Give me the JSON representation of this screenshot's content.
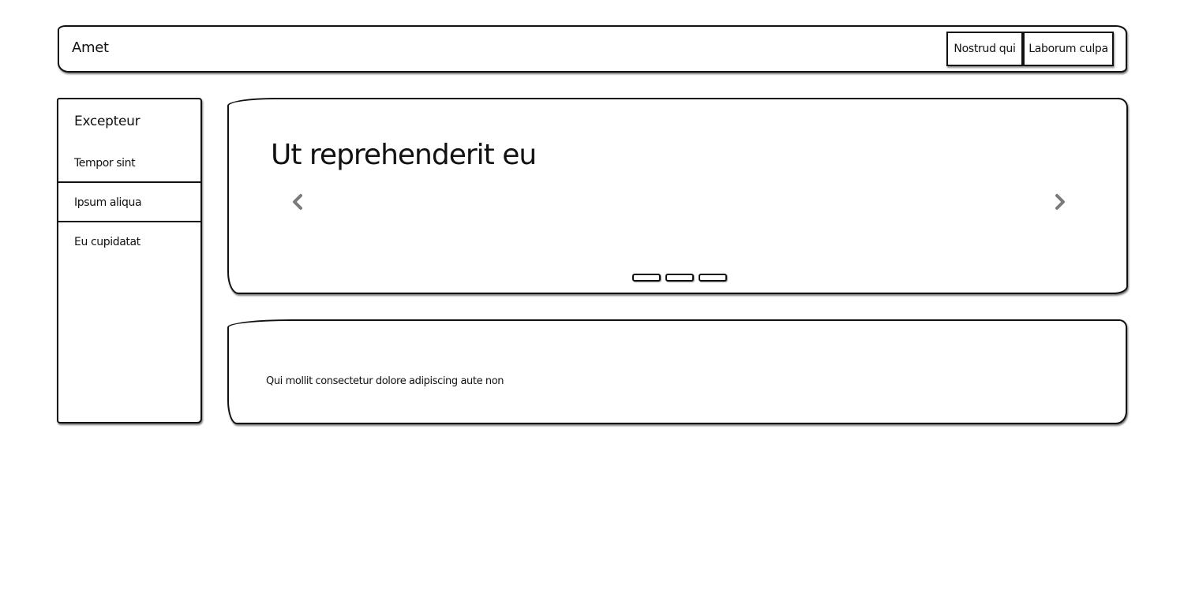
{
  "header": {
    "brand": "Amet",
    "nav_buttons": [
      "Nostrud qui",
      "Laborum culpa"
    ]
  },
  "sidebar": {
    "title": "Excepteur",
    "items": [
      "Tempor sint",
      "Ipsum aliqua",
      "Eu cupidatat"
    ]
  },
  "hero": {
    "heading": "Ut reprehenderit eu",
    "prev_icon": "chevron-left-icon",
    "next_icon": "chevron-right-icon",
    "slide_count": 3,
    "chevron_color": "#7a7a7a"
  },
  "card": {
    "text": "Qui mollit consectetur dolore adipiscing aute non"
  }
}
